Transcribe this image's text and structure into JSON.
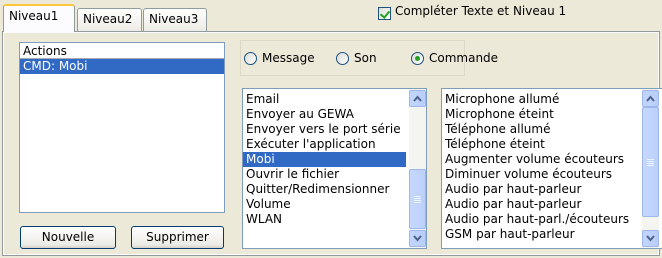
{
  "tabs": [
    "Niveau1",
    "Niveau2",
    "Niveau3"
  ],
  "complete_checkbox_label": "Compléter Texte et Niveau 1",
  "actions": {
    "label": "Actions",
    "items": [
      "CMD: Mobi"
    ]
  },
  "buttons": {
    "new": "Nouvelle",
    "delete": "Supprimer"
  },
  "type_options": {
    "message": "Message",
    "sound": "Son",
    "command": "Commande",
    "selected": "Commande"
  },
  "commands": {
    "items": [
      "Email",
      "Envoyer au GEWA",
      "Envoyer vers le port série",
      "Exécuter l'application",
      "Mobi",
      "Ouvrir le fichier",
      "Quitter/Redimensionner",
      "Volume",
      "WLAN"
    ],
    "selected": "Mobi"
  },
  "mobi_functions": {
    "items": [
      "Microphone allumé",
      "Microphone éteint",
      "Téléphone allumé",
      "Téléphone éteint",
      "Augmenter volume écouteurs",
      "Diminuer volume écouteurs",
      "Audio par haut-parleur",
      "Audio par haut-parleur",
      "Audio par haut-parl./écouteurs",
      "GSM par haut-parleur"
    ]
  }
}
